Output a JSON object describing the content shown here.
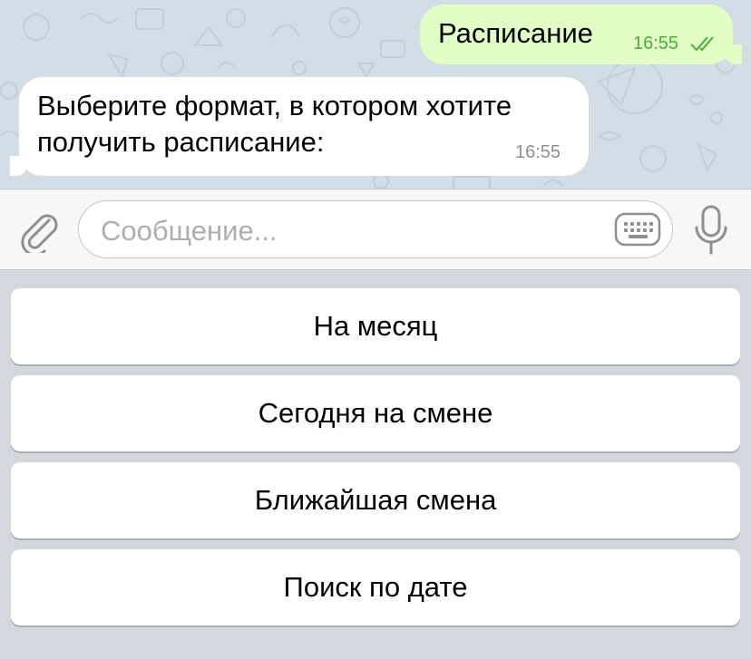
{
  "chat": {
    "outgoing": {
      "text": "Расписание",
      "time": "16:55",
      "status": "read-double-check"
    },
    "incoming": {
      "text": "Выберите формат, в котором хотите получить расписание:",
      "time": "16:55"
    }
  },
  "input": {
    "placeholder": "Сообщение...",
    "attach_icon": "paperclip-icon",
    "keyboard_icon": "keyboard-icon",
    "mic_icon": "microphone-icon"
  },
  "keyboard": {
    "buttons": [
      {
        "label": "На месяц"
      },
      {
        "label": "Сегодня на смене"
      },
      {
        "label": "Ближайшая смена"
      },
      {
        "label": "Поиск по дате"
      }
    ]
  },
  "colors": {
    "chat_background": "#d3dde6",
    "outgoing_bubble": "#e1fec6",
    "incoming_bubble": "#ffffff",
    "read_check": "#4bad3a",
    "keyboard_background": "#d4d8de",
    "icon_gray": "#8e8e93"
  }
}
